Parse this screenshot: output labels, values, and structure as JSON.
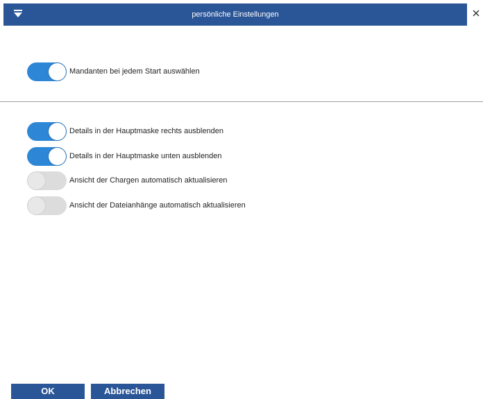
{
  "dialog": {
    "title": "persönliche Einstellungen"
  },
  "options": [
    {
      "label": "Mandanten bei jedem Start auswählen",
      "enabled": true
    },
    {
      "label": "Details in der Hauptmaske rechts ausblenden",
      "enabled": true
    },
    {
      "label": "Details in der Hauptmaske unten ausblenden",
      "enabled": true
    },
    {
      "label": "Ansicht der Chargen automatisch aktualisieren",
      "enabled": false
    },
    {
      "label": "Ansicht der Dateianhänge automatisch aktualisieren",
      "enabled": false
    }
  ],
  "buttons": {
    "ok_label": "OK",
    "cancel_label": "Abbrechen"
  },
  "icons": {
    "menu": "chevron-down-icon",
    "close": "close-icon"
  },
  "colors": {
    "titlebar": "#2a5597",
    "toggle_on": "#2e86d6",
    "toggle_off": "#dcdcdc"
  }
}
